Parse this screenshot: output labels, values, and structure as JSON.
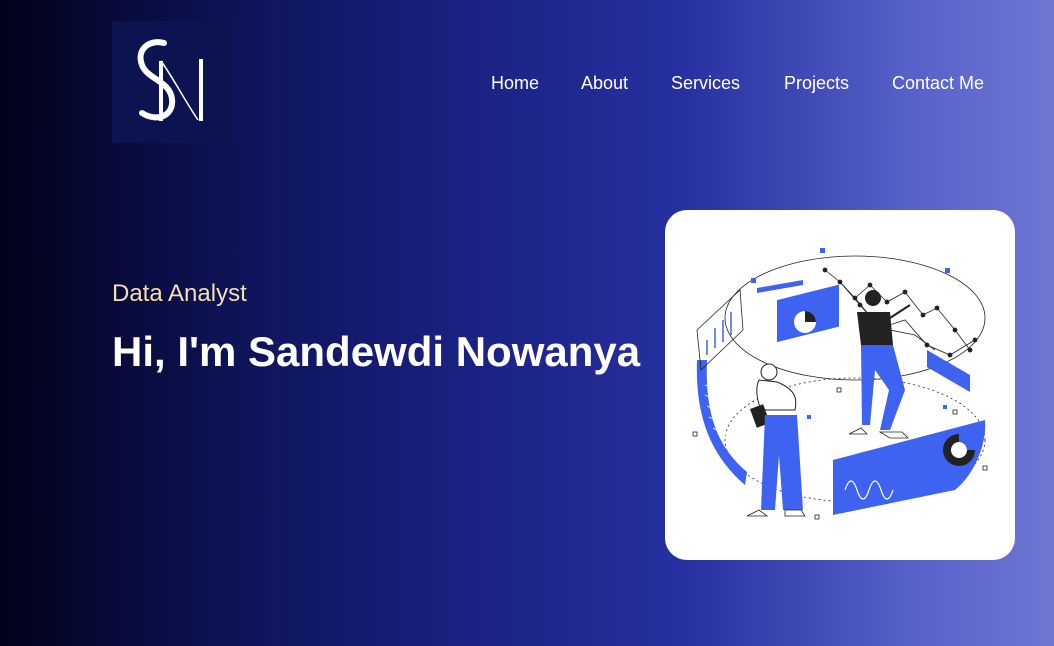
{
  "brand": {
    "logo_text": "SN",
    "logo_icon": "sn-monogram-logo"
  },
  "nav": {
    "items": [
      {
        "label": "Home"
      },
      {
        "label": "About"
      },
      {
        "label": "Services"
      },
      {
        "label": "Projects"
      },
      {
        "label": "Contact Me"
      }
    ]
  },
  "hero": {
    "role": "Data Analyst",
    "headline": "Hi, I'm Sandewdi Nowanya",
    "illustration": "data-analytics-illustration"
  },
  "colors": {
    "role_text": "#f5dfae",
    "accent_blue": "#3d63f0",
    "background_gradient": [
      "#01021a",
      "#1b2283",
      "#2630a0",
      "#6f77d2"
    ]
  }
}
